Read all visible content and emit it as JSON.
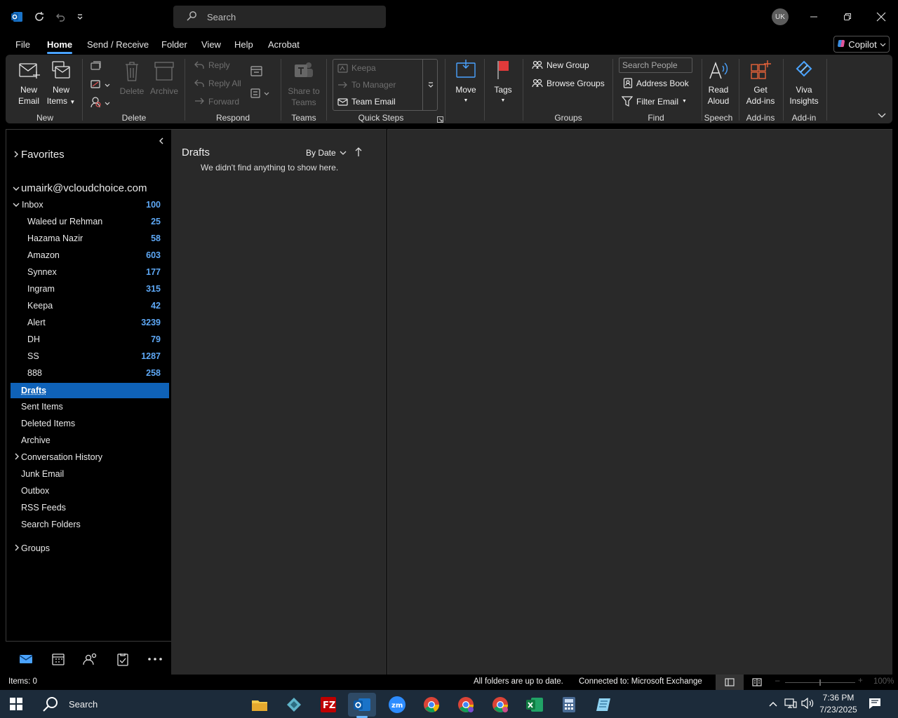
{
  "titlebar": {
    "search_placeholder": "Search",
    "avatar_initials": "UK"
  },
  "menu": {
    "tabs": [
      "File",
      "Home",
      "Send / Receive",
      "Folder",
      "View",
      "Help",
      "Acrobat"
    ],
    "active": "Home",
    "copilot_label": "Copilot"
  },
  "ribbon": {
    "new_email": [
      "New",
      "Email"
    ],
    "new_items": [
      "New",
      "Items"
    ],
    "delete": "Delete",
    "archive": "Archive",
    "reply": "Reply",
    "reply_all": "Reply All",
    "forward": "Forward",
    "share_to_teams": [
      "Share to",
      "Teams"
    ],
    "quick_steps": [
      "Keepa",
      "To Manager",
      "Team Email"
    ],
    "move": "Move",
    "tags": "Tags",
    "new_group": "New Group",
    "browse_groups": "Browse Groups",
    "search_people_placeholder": "Search People",
    "address_book": "Address Book",
    "filter_email": "Filter Email",
    "read_aloud": [
      "Read",
      "Aloud"
    ],
    "get_addins": [
      "Get",
      "Add-ins"
    ],
    "viva_insights": [
      "Viva",
      "Insights"
    ],
    "groups": {
      "new": "New",
      "delete": "Delete",
      "respond": "Respond",
      "teams": "Teams",
      "quick_steps": "Quick Steps",
      "groups": "Groups",
      "find": "Find",
      "speech": "Speech",
      "addins": "Add-ins",
      "addin": "Add-in"
    }
  },
  "folders": {
    "favorites": "Favorites",
    "account": "umairk@vcloudchoice.com",
    "inbox": {
      "label": "Inbox",
      "count": "100"
    },
    "subfolders": [
      {
        "label": "Waleed ur Rehman",
        "count": "25"
      },
      {
        "label": "Hazama Nazir",
        "count": "58"
      },
      {
        "label": "Amazon",
        "count": "603"
      },
      {
        "label": "Synnex",
        "count": "177"
      },
      {
        "label": "Ingram",
        "count": "315"
      },
      {
        "label": "Keepa",
        "count": "42"
      },
      {
        "label": "Alert",
        "count": "3239"
      },
      {
        "label": "DH",
        "count": "79"
      },
      {
        "label": "SS",
        "count": "1287"
      },
      {
        "label": "888",
        "count": "258"
      }
    ],
    "others": [
      "Drafts",
      "Sent Items",
      "Deleted Items",
      "Archive",
      "Conversation History",
      "Junk Email",
      "Outbox",
      "RSS Feeds",
      "Search Folders"
    ],
    "selected": "Drafts",
    "groups": "Groups"
  },
  "message_list": {
    "title": "Drafts",
    "sort": "By Date",
    "empty_text": "We didn't find anything to show here."
  },
  "status": {
    "items": "Items: 0",
    "sync": "All folders are up to date.",
    "connection": "Connected to: Microsoft Exchange",
    "zoom": "100%"
  },
  "taskbar": {
    "search": "Search",
    "time": "7:36 PM",
    "date": "7/23/2025"
  },
  "colors": {
    "accent": "#0f62b8",
    "count": "#5ea8f5",
    "ribbon": "#292929"
  }
}
